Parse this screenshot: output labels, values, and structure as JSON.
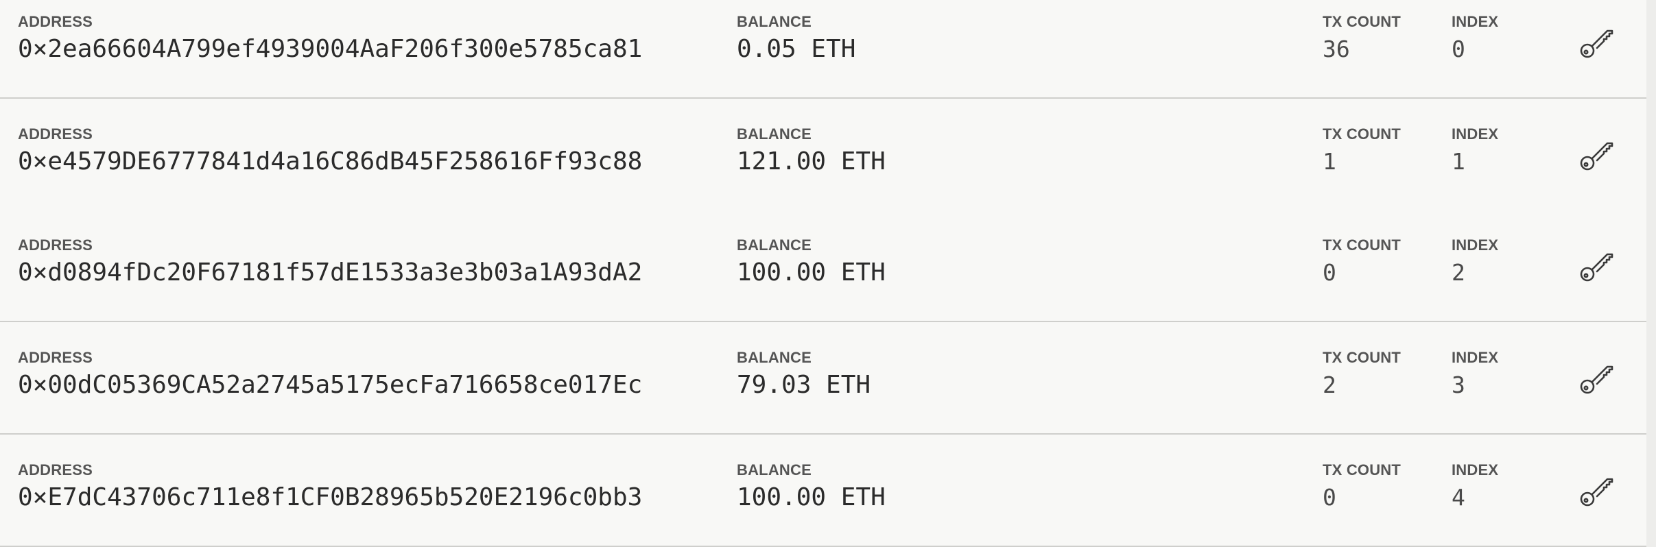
{
  "labels": {
    "address": "ADDRESS",
    "balance": "BALANCE",
    "tx_count": "TX COUNT",
    "index": "INDEX"
  },
  "accounts": [
    {
      "address": "0×2ea66604A799ef4939004AaF206f300e5785ca81",
      "balance": "0.05 ETH",
      "tx_count": "36",
      "index": "0",
      "key_icon": "key-icon"
    },
    {
      "address": "0×e4579DE6777841d4a16C86dB45F258616Ff93c88",
      "balance": "121.00 ETH",
      "tx_count": "1",
      "index": "1",
      "key_icon": "key-icon"
    },
    {
      "address": "0×d0894fDc20F67181f57dE1533a3e3b03a1A93dA2",
      "balance": "100.00 ETH",
      "tx_count": "0",
      "index": "2",
      "key_icon": "key-icon"
    },
    {
      "address": "0×00dC05369CA52a2745a5175ecFa716658ce017Ec",
      "balance": "79.03 ETH",
      "tx_count": "2",
      "index": "3",
      "key_icon": "key-icon"
    },
    {
      "address": "0×E7dC43706c711e8f1CF0B28965b520E2196c0bb3",
      "balance": "100.00 ETH",
      "tx_count": "0",
      "index": "4",
      "key_icon": "key-icon"
    }
  ],
  "colors": {
    "background": "#f8f8f6",
    "divider": "#cfcfcc",
    "label": "#555555",
    "value": "#2b2b2b"
  }
}
